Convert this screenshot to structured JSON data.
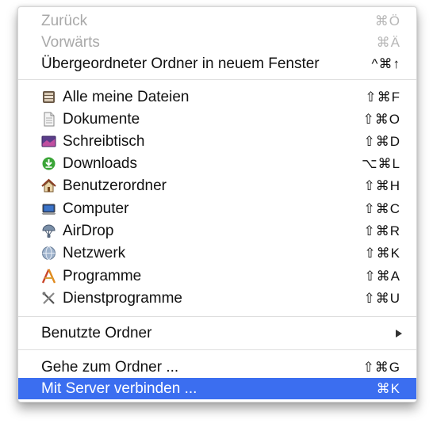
{
  "menu": {
    "back": {
      "label": "Zurück",
      "shortcut": "⌘Ö"
    },
    "forward": {
      "label": "Vorwärts",
      "shortcut": "⌘Ä"
    },
    "parent_folder": {
      "label": "Übergeordneter Ordner in neuem Fenster",
      "shortcut": "^⌘↑"
    },
    "places": [
      {
        "label": "Alle meine Dateien",
        "shortcut": "⇧⌘F",
        "icon": "all-files-icon"
      },
      {
        "label": "Dokumente",
        "shortcut": "⇧⌘O",
        "icon": "documents-icon"
      },
      {
        "label": "Schreibtisch",
        "shortcut": "⇧⌘D",
        "icon": "desktop-icon"
      },
      {
        "label": "Downloads",
        "shortcut": "⌥⌘L",
        "icon": "downloads-icon"
      },
      {
        "label": "Benutzerordner",
        "shortcut": "⇧⌘H",
        "icon": "home-icon"
      },
      {
        "label": "Computer",
        "shortcut": "⇧⌘C",
        "icon": "computer-icon"
      },
      {
        "label": "AirDrop",
        "shortcut": "⇧⌘R",
        "icon": "airdrop-icon"
      },
      {
        "label": "Netzwerk",
        "shortcut": "⇧⌘K",
        "icon": "network-icon"
      },
      {
        "label": "Programme",
        "shortcut": "⇧⌘A",
        "icon": "applications-icon"
      },
      {
        "label": "Dienstprogramme",
        "shortcut": "⇧⌘U",
        "icon": "utilities-icon"
      }
    ],
    "recent_folders": {
      "label": "Benutzte Ordner"
    },
    "go_to_folder": {
      "label": "Gehe zum Ordner ...",
      "shortcut": "⇧⌘G"
    },
    "connect_server": {
      "label": "Mit Server verbinden ...",
      "shortcut": "⌘K"
    }
  },
  "colors": {
    "selection": "#3b6ef0",
    "disabled_text": "#a9a9a9"
  }
}
